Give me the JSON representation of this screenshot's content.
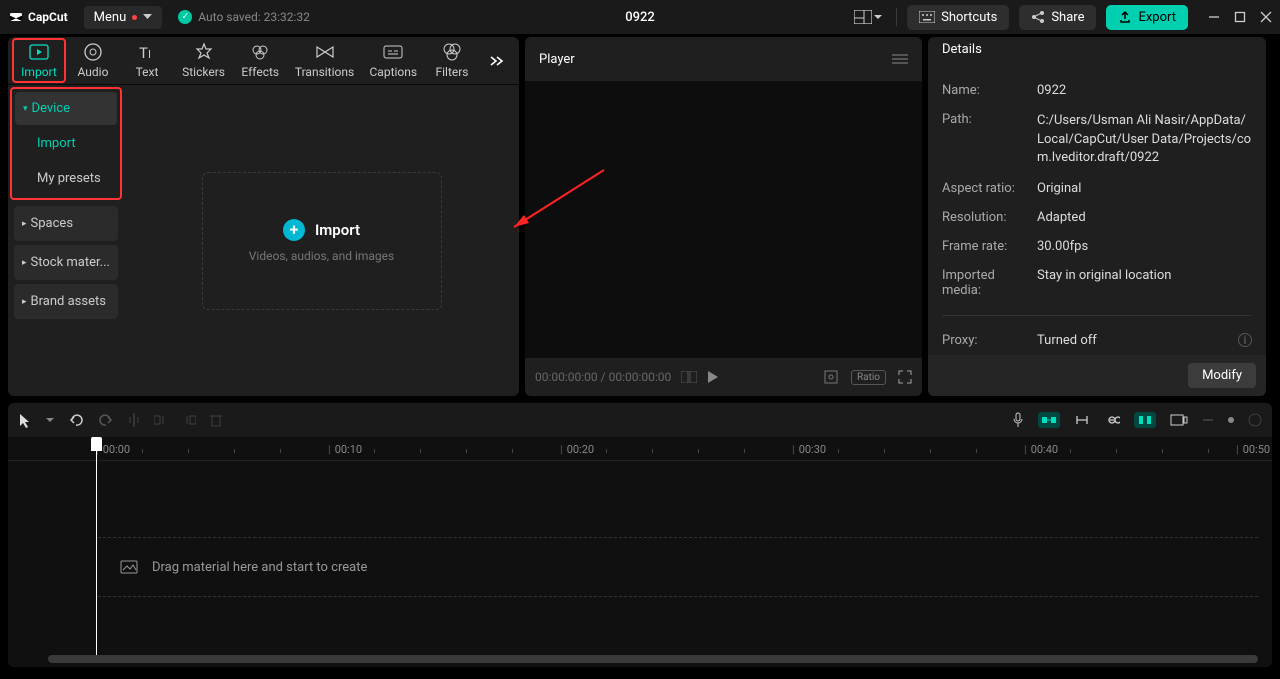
{
  "title_bar": {
    "app_name": "CapCut",
    "menu_label": "Menu",
    "auto_saved": "Auto saved: 23:32:32",
    "project_title": "0922",
    "shortcuts": "Shortcuts",
    "share": "Share",
    "export": "Export"
  },
  "tabs": {
    "import": "Import",
    "audio": "Audio",
    "text": "Text",
    "stickers": "Stickers",
    "effects": "Effects",
    "transitions": "Transitions",
    "captions": "Captions",
    "filters": "Filters"
  },
  "sidebar": {
    "device": "Device",
    "import": "Import",
    "my_presets": "My presets",
    "spaces": "Spaces",
    "stock": "Stock mater...",
    "brand": "Brand assets"
  },
  "import_zone": {
    "title": "Import",
    "subtitle": "Videos, audios, and images"
  },
  "player": {
    "header": "Player",
    "time": "00:00:00:00 / 00:00:00:00",
    "ratio": "Ratio"
  },
  "details": {
    "header": "Details",
    "name_label": "Name:",
    "name_value": "0922",
    "path_label": "Path:",
    "path_value": "C:/Users/Usman Ali Nasir/AppData/Local/CapCut/User Data/Projects/com.lveditor.draft/0922",
    "aspect_label": "Aspect ratio:",
    "aspect_value": "Original",
    "resolution_label": "Resolution:",
    "resolution_value": "Adapted",
    "framerate_label": "Frame rate:",
    "framerate_value": "30.00fps",
    "imported_label": "Imported media:",
    "imported_value": "Stay in original location",
    "proxy_label": "Proxy:",
    "proxy_value": "Turned off",
    "modify": "Modify"
  },
  "timeline": {
    "ticks": [
      "00:00",
      "00:10",
      "00:20",
      "00:30",
      "00:40",
      "00:50"
    ],
    "drag_hint": "Drag material here and start to create"
  }
}
